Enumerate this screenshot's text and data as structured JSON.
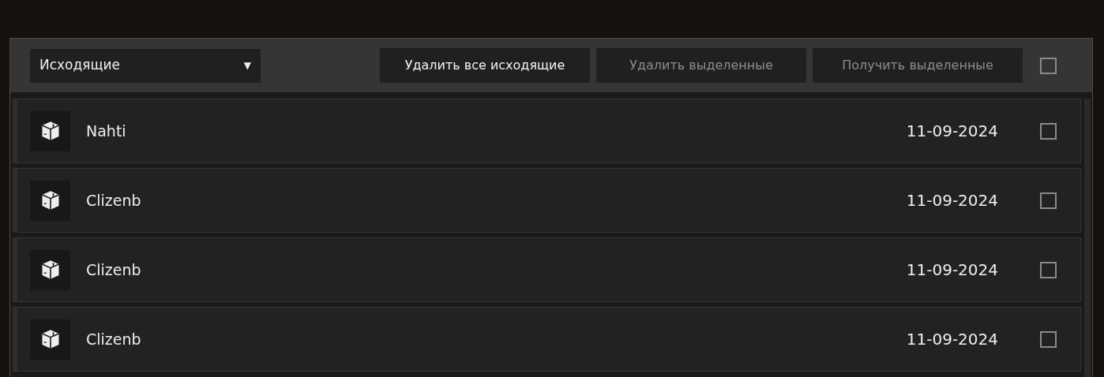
{
  "toolbar": {
    "dropdown": {
      "value": "Исходящие",
      "caret": "▼"
    },
    "buttons": [
      {
        "label": "Удалить все исходящие",
        "disabled": false
      },
      {
        "label": "Удалить выделенные",
        "disabled": true
      },
      {
        "label": "Получить выделенные",
        "disabled": true
      }
    ],
    "select_all": {
      "checked": false
    }
  },
  "messages": [
    {
      "sender": "Nahti",
      "date": "11-09-2024",
      "checked": false
    },
    {
      "sender": "Clizenb",
      "date": "11-09-2024",
      "checked": false
    },
    {
      "sender": "Clizenb",
      "date": "11-09-2024",
      "checked": false
    },
    {
      "sender": "Clizenb",
      "date": "11-09-2024",
      "checked": false
    }
  ]
}
